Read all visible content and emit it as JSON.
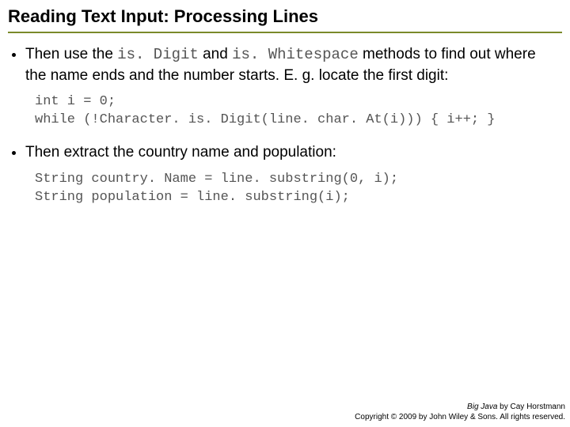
{
  "title": "Reading Text Input: Processing Lines",
  "bullets": {
    "b1_pre": "Then use the ",
    "b1_code1": "is. Digit",
    "b1_mid1": " and ",
    "b1_code2": "is. Whitespace",
    "b1_post": " methods to find out where the name ends and the number starts. E. g. locate the first digit:",
    "code1_line1": "int i = 0;",
    "code1_line2": "while (!Character. is. Digit(line. char. At(i))) { i++; }",
    "b2": "Then extract the country name and population:",
    "code2_line1": "String country. Name = line. substring(0, i);",
    "code2_line2": "String population = line. substring(i);"
  },
  "footer": {
    "book": "Big Java",
    "author": " by Cay Horstmann",
    "copyright": "Copyright © 2009 by John Wiley & Sons. All rights reserved."
  }
}
